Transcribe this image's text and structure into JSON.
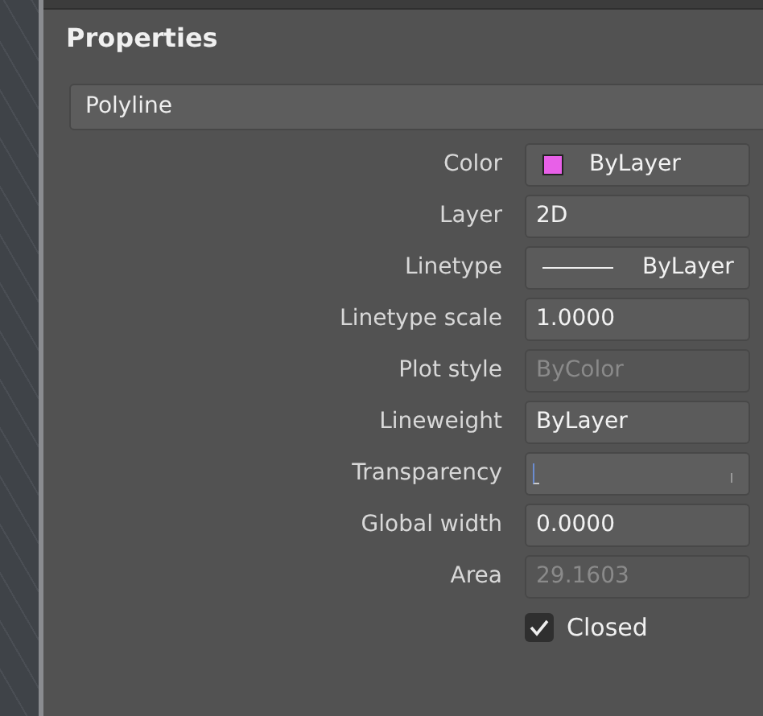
{
  "panel": {
    "title": "Properties",
    "object_type": "Polyline"
  },
  "rows": [
    {
      "label": "Color",
      "kind": "color",
      "value": "ByLayer",
      "color": "#e860e8",
      "disabled": false
    },
    {
      "label": "Layer",
      "kind": "text",
      "value": "2D",
      "disabled": false
    },
    {
      "label": "Linetype",
      "kind": "linetype",
      "value": "ByLayer",
      "disabled": false
    },
    {
      "label": "Linetype scale",
      "kind": "text",
      "value": "1.0000",
      "disabled": false
    },
    {
      "label": "Plot style",
      "kind": "text",
      "value": "ByColor",
      "disabled": true
    },
    {
      "label": "Lineweight",
      "kind": "text",
      "value": "ByLayer",
      "disabled": false
    },
    {
      "label": "Transparency",
      "kind": "slider",
      "level": 0,
      "disabled": false
    },
    {
      "label": "Global width",
      "kind": "text",
      "value": "0.0000",
      "disabled": false
    },
    {
      "label": "Area",
      "kind": "text",
      "value": "29.1603",
      "disabled": true
    },
    {
      "label": "Closed",
      "kind": "checkbox",
      "checked": true,
      "disabled": false
    }
  ]
}
